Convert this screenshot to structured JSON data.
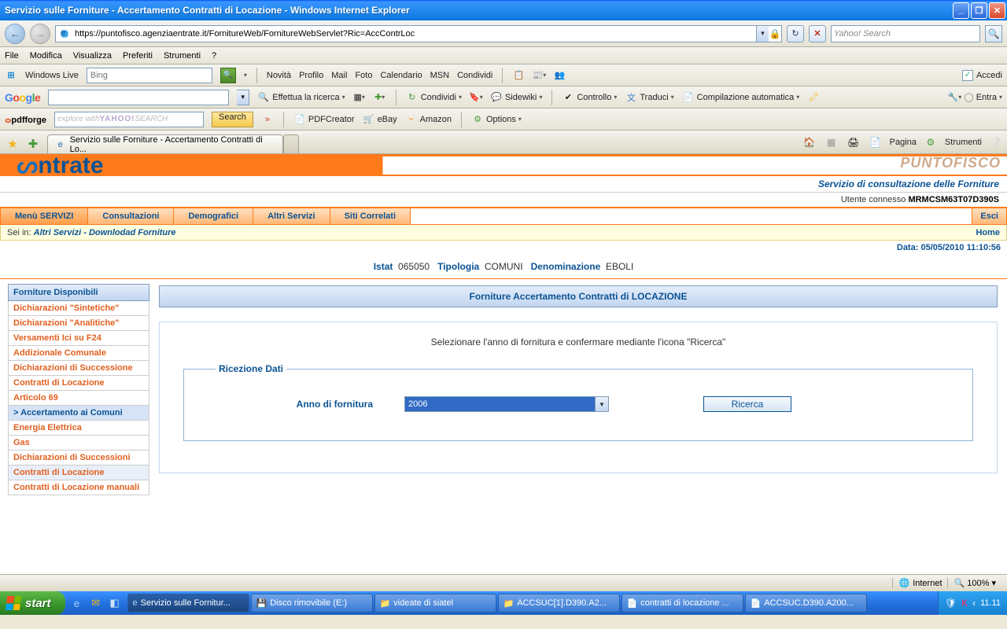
{
  "window": {
    "title": "Servizio sulle Forniture - Accertamento Contratti di Locazione - Windows Internet Explorer"
  },
  "address": {
    "url": "https://puntofisco.agenziaentrate.it/FornitureWeb/FornitureWebServlet?Ric=AccContrLoc",
    "yahoo_placeholder": "Yahoo! Search"
  },
  "browser_menu": [
    "File",
    "Modifica",
    "Visualizza",
    "Preferiti",
    "Strumenti",
    "?"
  ],
  "winlive": {
    "label": "Windows Live",
    "bing": "Bing",
    "items": [
      "Novità",
      "Profilo",
      "Mail",
      "Foto",
      "Calendario",
      "MSN",
      "Condividi"
    ],
    "accedi": "Accedi"
  },
  "google": {
    "search": "Effettua la ricerca",
    "condividi": "Condividi",
    "sidewiki": "Sidewiki",
    "controllo": "Controllo",
    "traduci": "Traduci",
    "compilazione": "Compilazione automatica",
    "entra": "Entra"
  },
  "pdfforge": {
    "yahoo_placeholder": "explore with YAHOO! SEARCH",
    "search": "Search",
    "pdfcreator": "PDFCreator",
    "ebay": "eBay",
    "amazon": "Amazon",
    "options": "Options"
  },
  "tab": {
    "title": "Servizio sulle Forniture - Accertamento Contratti di Lo..."
  },
  "tabright": {
    "pagina": "Pagina",
    "strumenti": "Strumenti"
  },
  "page": {
    "logo": "ntrate",
    "puntofisco": "PUNTOFISCO",
    "subtitle": "Servizio di consultazione delle Forniture",
    "utente_label": "Utente connesso",
    "utente": "MRMCSM63T07D390S",
    "menu": [
      "Menù SERVIZI",
      "Consultazioni",
      "Demografici",
      "Altri Servizi",
      "Siti Correlati"
    ],
    "esci": "Esci",
    "breadcrumb_label": "Sei in:",
    "breadcrumb": "Altri Servizi - Downlodad Forniture",
    "home": "Home",
    "data_label": "Data:",
    "data": "05/05/2010 11:10:56",
    "istat_label": "Istat",
    "istat": "065050",
    "tipologia_label": "Tipologia",
    "tipologia": "COMUNI",
    "denominazione_label": "Denominazione",
    "denominazione": "EBOLI"
  },
  "sidebar": {
    "head": "Forniture Disponibili",
    "items": [
      "Dichiarazioni \"Sintetiche\"",
      "Dichiarazioni \"Analitiche\"",
      "Versamenti Ici su F24",
      "Addizionale Comunale",
      "Dichiarazioni di Successione",
      "Contratti di Locazione",
      "Articolo 69",
      "> Accertamento ai Comuni",
      "Energia Elettrica",
      "Gas",
      "Dichiarazioni di Successioni",
      "Contratti di Locazione",
      "Contratti di Locazione manuali"
    ]
  },
  "panel": {
    "head": "Forniture Accertamento Contratti di LOCAZIONE",
    "msg": "Selezionare l'anno di fornitura e confermare mediante l'icona \"Ricerca\"",
    "legend": "Ricezione Dati",
    "anno_label": "Anno di fornitura",
    "anno_value": "2006",
    "ricerca": "Ricerca"
  },
  "iestatus": {
    "internet": "Internet",
    "zoom": "100%"
  },
  "taskbar": {
    "start": "start",
    "buttons": [
      "Servizio sulle Fornitur...",
      "Disco rimovibile (E:)",
      "videate di siatel",
      "ACCSUC[1].D390.A2...",
      "contratti di locazione ...",
      "ACCSUC.D390.A200..."
    ],
    "clock": "11.11"
  }
}
